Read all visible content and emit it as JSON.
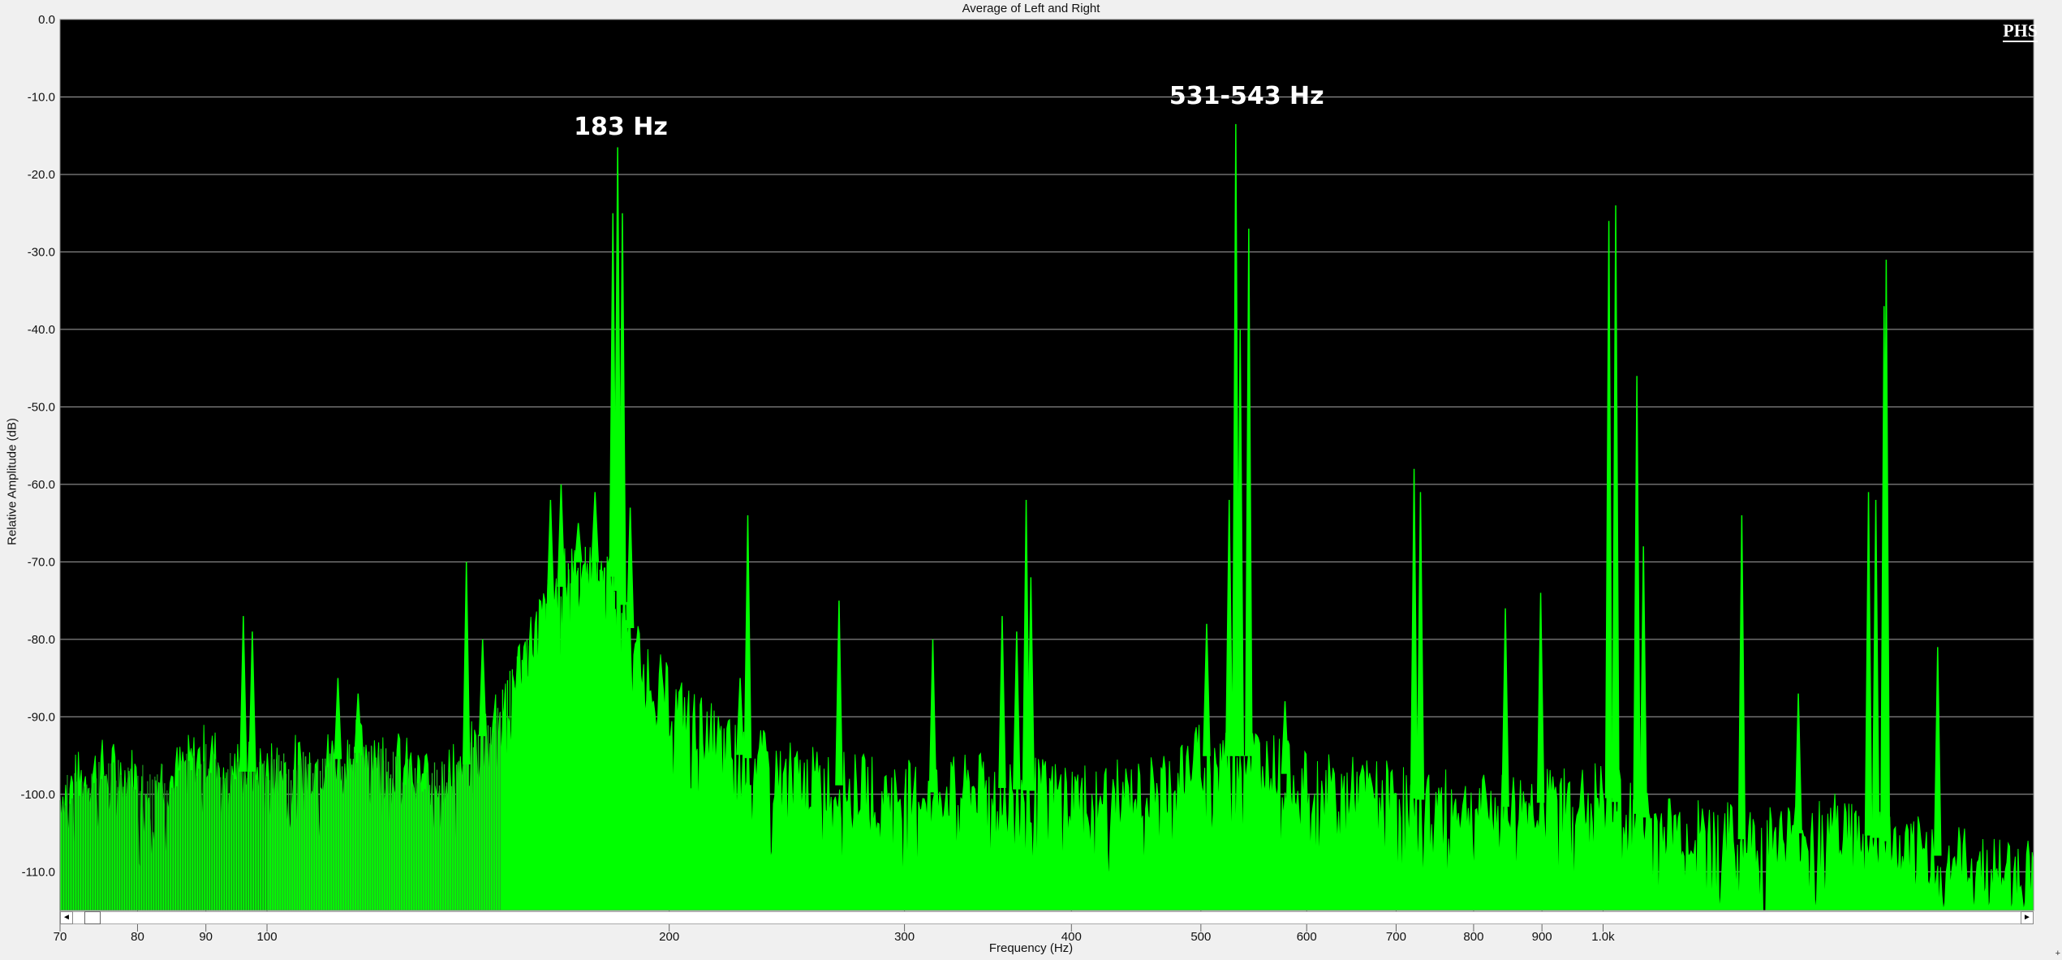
{
  "chart_data": {
    "type": "area",
    "title": "Average of Left and Right",
    "xlabel": "Frequency (Hz)",
    "ylabel": "Relative Amplitude (dB)",
    "xscale": "log",
    "xlim": [
      70,
      2100
    ],
    "ylim": [
      -115,
      0
    ],
    "grid": true,
    "background_color": "#000000",
    "fill_color": "#00ff00",
    "dim_fill_color": "#1a9e1a",
    "x_ticks": [
      {
        "value": 70,
        "label": "70"
      },
      {
        "value": 80,
        "label": "80"
      },
      {
        "value": 90,
        "label": "90"
      },
      {
        "value": 100,
        "label": "100"
      },
      {
        "value": 200,
        "label": "200"
      },
      {
        "value": 300,
        "label": "300"
      },
      {
        "value": 400,
        "label": "400"
      },
      {
        "value": 500,
        "label": "500"
      },
      {
        "value": 600,
        "label": "600"
      },
      {
        "value": 700,
        "label": "700"
      },
      {
        "value": 800,
        "label": "800"
      },
      {
        "value": 900,
        "label": "900"
      },
      {
        "value": 1000,
        "label": "1.0k"
      }
    ],
    "y_ticks": [
      {
        "value": 0,
        "label": "0.0"
      },
      {
        "value": -10,
        "label": "-10.0"
      },
      {
        "value": -20,
        "label": "-20.0"
      },
      {
        "value": -30,
        "label": "-30.0"
      },
      {
        "value": -40,
        "label": "-40.0"
      },
      {
        "value": -50,
        "label": "-50.0"
      },
      {
        "value": -60,
        "label": "-60.0"
      },
      {
        "value": -70,
        "label": "-70.0"
      },
      {
        "value": -80,
        "label": "-80.0"
      },
      {
        "value": -90,
        "label": "-90.0"
      },
      {
        "value": -100,
        "label": "-100.0"
      },
      {
        "value": -110,
        "label": "-110.0"
      }
    ],
    "noise_floor_points": [
      [
        70,
        -100
      ],
      [
        75,
        -97
      ],
      [
        80,
        -98
      ],
      [
        85,
        -98
      ],
      [
        90,
        -95
      ],
      [
        95,
        -97
      ],
      [
        100,
        -97
      ],
      [
        110,
        -96
      ],
      [
        120,
        -94
      ],
      [
        130,
        -98
      ],
      [
        140,
        -97
      ],
      [
        150,
        -88
      ],
      [
        160,
        -78
      ],
      [
        170,
        -70
      ],
      [
        180,
        -70
      ],
      [
        190,
        -82
      ],
      [
        200,
        -88
      ],
      [
        220,
        -94
      ],
      [
        250,
        -98
      ],
      [
        300,
        -100
      ],
      [
        350,
        -99
      ],
      [
        400,
        -100
      ],
      [
        450,
        -100
      ],
      [
        500,
        -95
      ],
      [
        550,
        -95
      ],
      [
        600,
        -99
      ],
      [
        700,
        -100
      ],
      [
        800,
        -102
      ],
      [
        900,
        -101
      ],
      [
        1000,
        -100
      ],
      [
        1100,
        -104
      ],
      [
        1300,
        -106
      ],
      [
        1500,
        -104
      ],
      [
        1700,
        -107
      ],
      [
        2000,
        -110
      ],
      [
        2100,
        -110
      ]
    ],
    "peaks": [
      {
        "x": 96,
        "y": -77
      },
      {
        "x": 97.5,
        "y": -79
      },
      {
        "x": 113,
        "y": -85
      },
      {
        "x": 117,
        "y": -87
      },
      {
        "x": 141,
        "y": -70
      },
      {
        "x": 145,
        "y": -80
      },
      {
        "x": 163,
        "y": -62
      },
      {
        "x": 166,
        "y": -60
      },
      {
        "x": 171,
        "y": -65
      },
      {
        "x": 176,
        "y": -61
      },
      {
        "x": 181.5,
        "y": -25
      },
      {
        "x": 183,
        "y": -16.5
      },
      {
        "x": 184.5,
        "y": -25
      },
      {
        "x": 187,
        "y": -63
      },
      {
        "x": 229,
        "y": -64
      },
      {
        "x": 226,
        "y": -85
      },
      {
        "x": 268,
        "y": -75
      },
      {
        "x": 315,
        "y": -80
      },
      {
        "x": 355,
        "y": -77
      },
      {
        "x": 364,
        "y": -79
      },
      {
        "x": 370,
        "y": -62
      },
      {
        "x": 373,
        "y": -72
      },
      {
        "x": 505,
        "y": -78
      },
      {
        "x": 525,
        "y": -62
      },
      {
        "x": 531,
        "y": -13.5
      },
      {
        "x": 535,
        "y": -40
      },
      {
        "x": 543,
        "y": -27
      },
      {
        "x": 578,
        "y": -88
      },
      {
        "x": 722,
        "y": -58
      },
      {
        "x": 730,
        "y": -61
      },
      {
        "x": 845,
        "y": -76
      },
      {
        "x": 898,
        "y": -74
      },
      {
        "x": 1010,
        "y": -26
      },
      {
        "x": 1022,
        "y": -24
      },
      {
        "x": 1060,
        "y": -46
      },
      {
        "x": 1072,
        "y": -68
      },
      {
        "x": 1270,
        "y": -64
      },
      {
        "x": 1400,
        "y": -87
      },
      {
        "x": 1580,
        "y": -61
      },
      {
        "x": 1600,
        "y": -62
      },
      {
        "x": 1623,
        "y": -37
      },
      {
        "x": 1629,
        "y": -31
      },
      {
        "x": 1780,
        "y": -81
      }
    ],
    "annotations": [
      {
        "text": "183 Hz",
        "x": 183,
        "y": -15
      },
      {
        "text": "531-543 Hz",
        "x": 537,
        "y": -11
      }
    ]
  },
  "logo_text": "PHS",
  "scroll_left": "◄",
  "scroll_right": "►",
  "corner_glyph": "+"
}
